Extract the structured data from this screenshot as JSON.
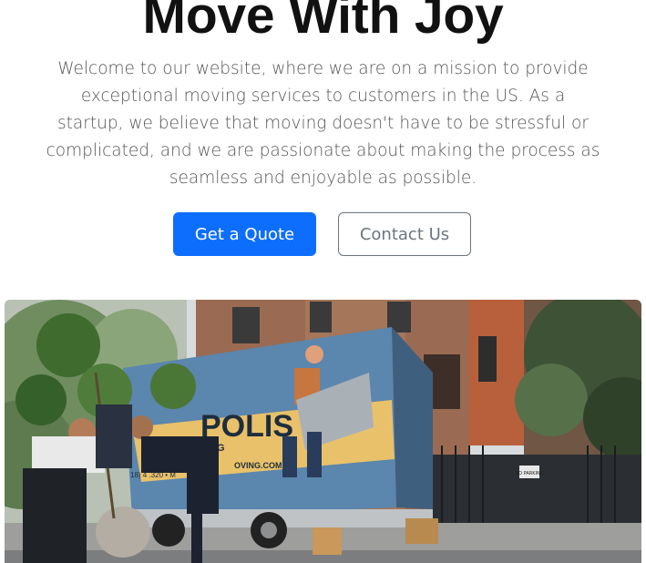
{
  "hero": {
    "title": "Move With Joy",
    "lead": "Welcome to our website, where we are on a mission to provide exceptional moving services to customers in the US. As a startup, we believe that moving doesn't have to be stressful or complicated, and we are passionate about making the process as seamless and enjoyable as possible.",
    "primary_button": "Get a Quote",
    "secondary_button": "Contact Us"
  },
  "photo": {
    "truck_text_brand": "POLIS",
    "truck_text_sub": "ING",
    "truck_text_phone": "18) 4 .320 • M",
    "truck_text_web": "OVING.COM",
    "sign_text": "NO PARKING"
  },
  "colors": {
    "primary": "#0d6efd",
    "outline": "#6c757d"
  }
}
